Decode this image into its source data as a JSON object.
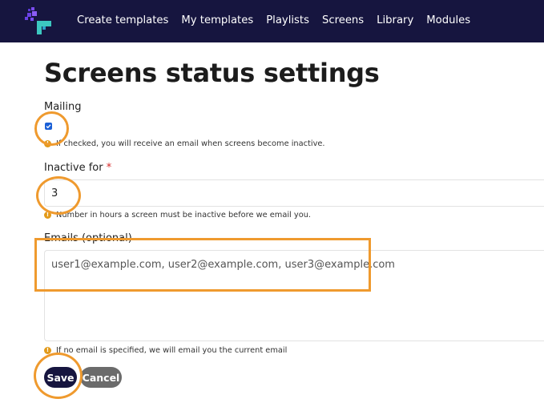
{
  "nav": {
    "items": [
      "Create templates",
      "My templates",
      "Playlists",
      "Screens",
      "Library",
      "Modules"
    ]
  },
  "page": {
    "title": "Screens status settings"
  },
  "form": {
    "mailing": {
      "label": "Mailing",
      "checked": true,
      "help": "If checked, you will receive an email when screens become inactive."
    },
    "inactive_for": {
      "label": "Inactive for",
      "required_mark": "*",
      "value": "3",
      "help": "Number in hours a screen must be inactive before we email you."
    },
    "emails": {
      "label": "Emails (optional)",
      "value": "user1@example.com, user2@example.com, user3@example.com",
      "help": "If no email is specified, we will email you the current email"
    },
    "save_label": "Save",
    "cancel_label": "Cancel"
  },
  "colors": {
    "topbar": "#16153f",
    "highlight": "#ef9a2e",
    "checkbox": "#1a5fd6",
    "help_icon": "#e29a1a",
    "required": "#d62828"
  }
}
